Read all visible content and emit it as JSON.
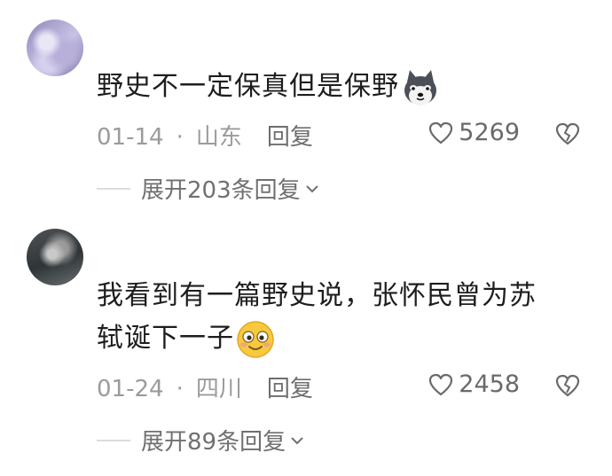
{
  "comments": [
    {
      "avatar_icon": "user-avatar",
      "text": "野史不一定保真但是保野",
      "emoji_icon": "husky-dog-emoji",
      "date": "01-14",
      "separator": "·",
      "location": "山东",
      "reply_label": "回复",
      "likes": "5269",
      "expand_label": "展开203条回复"
    },
    {
      "avatar_icon": "user-avatar",
      "text_line1": "我看到有一篇野史说，张怀民曾为苏",
      "text_line2": "轼诞下一子",
      "emoji_icon": "smile-emoji",
      "date": "01-24",
      "separator": "·",
      "location": "四川",
      "reply_label": "回复",
      "likes": "2458",
      "expand_label": "展开89条回复"
    }
  ],
  "colors": {
    "text": "#1d1d1d",
    "meta": "#9b9b9b",
    "secondary": "#6e6e6e"
  }
}
